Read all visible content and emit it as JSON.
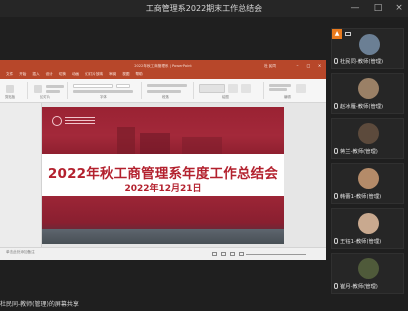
{
  "window": {
    "title": "工商管理系2022期末工作总结会",
    "controls": [
      "—",
      "□",
      "×"
    ]
  },
  "ppt": {
    "doc_title": "2022年秋工商管理系 | PowerPoint",
    "user": "杜 民同",
    "tabs": [
      "文件",
      "开始",
      "插入",
      "设计",
      "切换",
      "动画",
      "幻灯片放映",
      "审阅",
      "视图",
      "帮助"
    ],
    "groups": [
      "剪贴板",
      "幻灯片",
      "字体",
      "段落",
      "绘图",
      "编辑"
    ],
    "notes_placeholder": "单击此处添加备注",
    "slide": {
      "title": "2022年秋工商管理系年度工作总结会",
      "date": "2022年12月21日"
    }
  },
  "participants": [
    {
      "name": "杜民同-教师(管理)",
      "presenter": true
    },
    {
      "name": "赵冰雁-教师(管理)"
    },
    {
      "name": "蒋兰-教师(管理)"
    },
    {
      "name": "韩蕾1-教师(管理)"
    },
    {
      "name": "王钰1-教师(管理)"
    },
    {
      "name": "崔月-教师(管理)"
    }
  ],
  "footer": {
    "share_status": "杜民同-教师(管理)的屏幕共享"
  },
  "colors": {
    "ribbon": "#b7472a",
    "slide_text": "#b3212e",
    "slide_bg": "#8b1d2c",
    "presenter_badge": "#e87a1e"
  },
  "icons": [
    "minimize-icon",
    "maximize-icon",
    "close-icon",
    "mic-icon",
    "share-screen-icon"
  ]
}
